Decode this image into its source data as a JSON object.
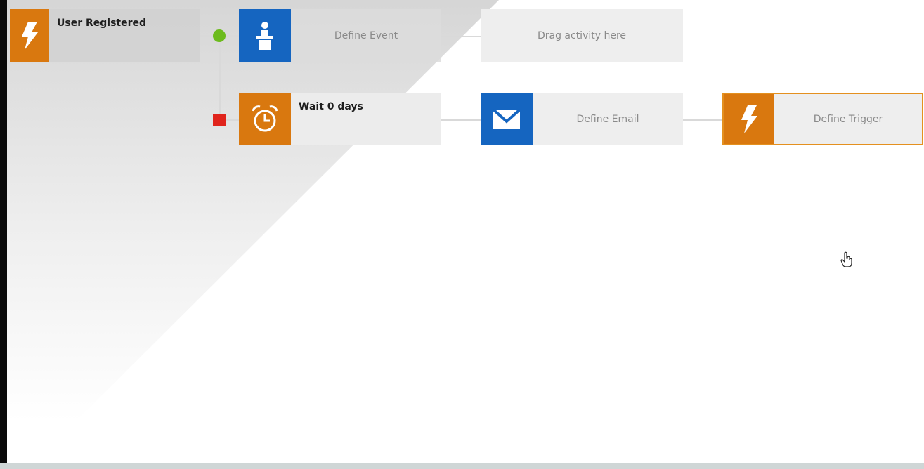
{
  "nodes": {
    "user_registered": {
      "label": "User Registered",
      "icon": "lightning-icon"
    },
    "define_event": {
      "label": "Define Event",
      "icon": "presenter-icon"
    },
    "drag_activity": {
      "label": "Drag activity here"
    },
    "wait": {
      "label": "Wait 0 days",
      "icon": "alarm-clock-icon"
    },
    "define_email": {
      "label": "Define Email",
      "icon": "envelope-icon"
    },
    "define_trigger": {
      "label": "Define Trigger",
      "icon": "lightning-icon"
    }
  },
  "branches": {
    "yes": {
      "color": "#6cbb1d",
      "shape": "circle"
    },
    "no": {
      "color": "#e0241c",
      "shape": "square"
    }
  },
  "colors": {
    "orange": "#d9780f",
    "blue": "#1565c0",
    "node_bg": "#eeeeee",
    "trigger_outline": "#e4901f"
  }
}
